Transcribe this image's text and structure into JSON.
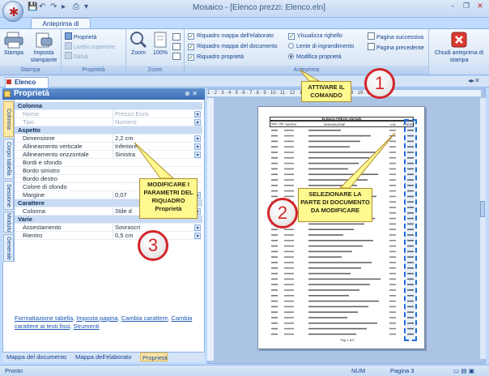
{
  "window": {
    "title": "Mosaico - [Elenco prezzi: Elenco.eln]",
    "controls": [
      "–",
      "❐",
      "✕"
    ]
  },
  "quick_access": [
    "💾",
    "↶",
    "↷",
    "▸",
    "⎙",
    "▾"
  ],
  "ribbon": {
    "active_tab": "Anteprima di stampa",
    "groups": {
      "stampa": {
        "title": "Stampa",
        "buttons": [
          "Stampa",
          "Imposta stampante"
        ]
      },
      "proprieta": {
        "title": "Proprietà",
        "items": [
          "Proprietà",
          "Livello superiore",
          "Salva"
        ]
      },
      "zoom": {
        "title": "Zoom",
        "zoom_label": "Zoom",
        "zoom_pct": "100%"
      },
      "anteprima": {
        "title": "Anteprima",
        "checks": [
          "Riquadro mappa dell'elaborato",
          "Riquadro mappa del documento",
          "Riquadro proprietà"
        ],
        "checks2": [
          "Visualizza righello",
          "Lente di ingrandimento",
          "Modifica proprietà"
        ],
        "nav": [
          "Pagina successiva",
          "Pagina precedente"
        ]
      },
      "close": {
        "label": "Chiudi anteprima di stampa"
      }
    }
  },
  "document_tab": "Elenco",
  "properties": {
    "title": "Proprietà",
    "side_tabs": [
      "Colonna",
      "Corpo tabella",
      "Sessione",
      "Modulo",
      "Generale"
    ],
    "rows": [
      {
        "type": "cat",
        "key": "Colonna"
      },
      {
        "type": "dim",
        "key": "Nome",
        "value": "Prezzo Euro"
      },
      {
        "type": "dim",
        "key": "Tipo",
        "value": "Numero"
      },
      {
        "type": "cat",
        "key": "Aspetto"
      },
      {
        "type": "row",
        "key": "Dimensione",
        "value": "2,2 cm"
      },
      {
        "type": "row",
        "key": "Allineamento verticale",
        "value": "Inferiore"
      },
      {
        "type": "row",
        "key": "Allineamento orizzontale",
        "value": "Sinistra"
      },
      {
        "type": "row",
        "key": "Bordi e sfondo",
        "value": ""
      },
      {
        "type": "row",
        "key": "Bordo sinistro",
        "value": ""
      },
      {
        "type": "row",
        "key": "Bordo destro",
        "value": ""
      },
      {
        "type": "row",
        "key": "Colore di sfondo",
        "value": ""
      },
      {
        "type": "row",
        "key": "Margine",
        "value": "0,07"
      },
      {
        "type": "cat",
        "key": "Carattere"
      },
      {
        "type": "row",
        "key": "Colonna",
        "value": "Stile d"
      },
      {
        "type": "cat",
        "key": "Varie"
      },
      {
        "type": "row",
        "key": "Assestamento",
        "value": "Sovrascri"
      },
      {
        "type": "row",
        "key": "Rientro",
        "value": "0,5 cm"
      }
    ],
    "links": [
      "Formattazione tabella",
      "Imposta pagina",
      "Cambia carattere",
      "Cambia carattere ai testi fissi",
      "Strumenti"
    ]
  },
  "bottom_tabs": [
    "Mappa del documento",
    "Mappa dell'elaborato",
    "Proprietà"
  ],
  "ruler_text": "1 · 2 · 3 · 4 · 5 · 6 · 7 · 8 · 9 · 10 · 11 · 12 · 13 · 14 · 15 · 16 · 17 · 18 · 19 · 20 · 21",
  "callouts": {
    "c1": "ATTIVARE IL COMANDO",
    "c2": "SELEZIONARE LA PARTE DI DOCUMENTO DA MODIFICARE",
    "c3": "MODIFICARE I PARAMETRI DEL RIQUADRO Proprietà",
    "n1": "1",
    "n2": "2",
    "n3": "3"
  },
  "page": {
    "header": "ELENCO PREZZI UNITARI",
    "columns": [
      "Num. Ord.",
      "TARIFFA",
      "DESIGNAZIONE",
      "U.M.",
      "PREZZO"
    ],
    "footer": "Pag. 1 di 5"
  },
  "status": {
    "left": "Pronto",
    "num": "NUM",
    "page": "Pagina 3"
  },
  "colors": {
    "accent": "#d3252a",
    "callout": "#fff98f",
    "selection": "#1b6be0"
  }
}
